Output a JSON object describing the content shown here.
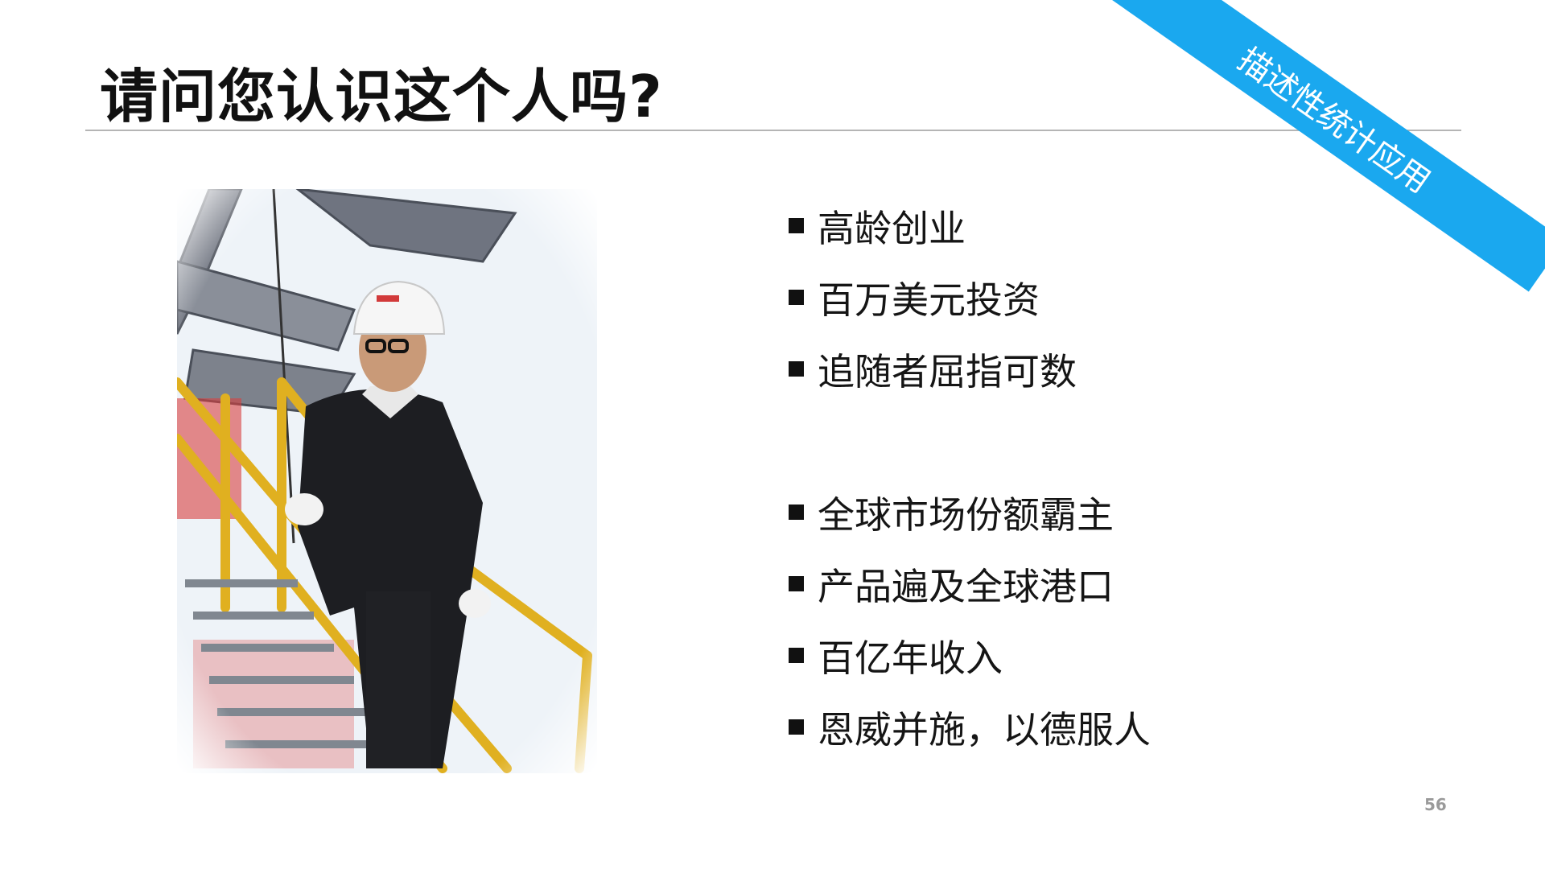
{
  "slide": {
    "title": "请问您认识这个人吗?",
    "corner_tag": "描述性统计应用",
    "accent_color": "#1aa8ef",
    "page_number": "56",
    "bullets_group1": [
      "高龄创业",
      "百万美元投资",
      "追随者屈指可数"
    ],
    "bullets_group2": [
      "全球市场份额霸主",
      "产品遍及全球港口",
      "百亿年收入",
      "恩威并施，以德服人"
    ]
  }
}
